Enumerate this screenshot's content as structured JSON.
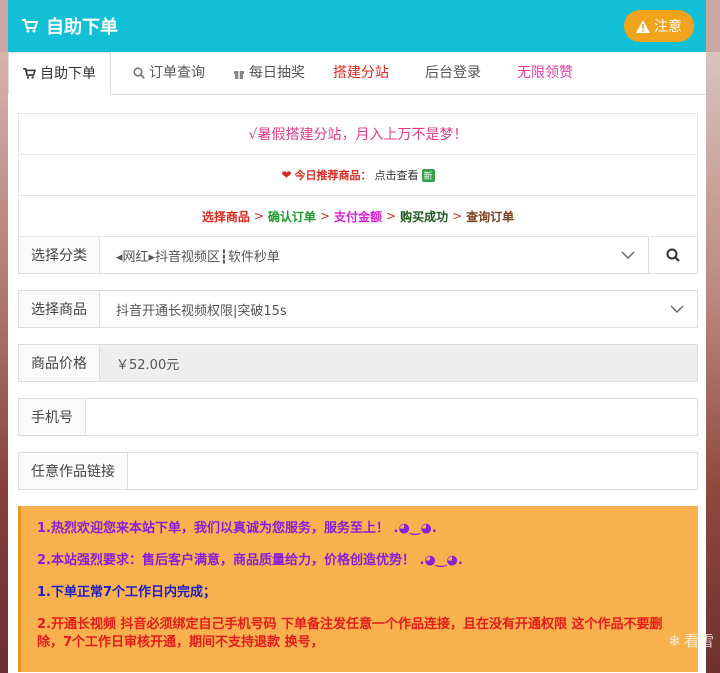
{
  "header": {
    "title": "自助下单",
    "notice_label": "注意"
  },
  "tabs": [
    {
      "label": "自助下单"
    },
    {
      "label": "订单查询"
    },
    {
      "label": "每日抽奖"
    },
    {
      "label": "搭建分站"
    },
    {
      "label": "后台登录"
    },
    {
      "label": "无限领赞"
    }
  ],
  "info": {
    "slogan": "√暑假搭建分站，月入上万不是梦！",
    "rec_label": "今日推荐商品：",
    "rec_link": "点击查看",
    "rec_badge": "新",
    "steps": [
      "选择商品",
      "确认订单",
      "支付金额",
      "购买成功",
      "查询订单"
    ],
    "step_arrow": ">"
  },
  "form": {
    "category": {
      "label": "选择分类",
      "value": "◂网红▸抖音视频区┇软件秒单"
    },
    "product": {
      "label": "选择商品",
      "value": "抖音开通长视频权限|突破15s"
    },
    "price": {
      "label": "商品价格",
      "value": "￥52.00元"
    },
    "phone": {
      "label": "手机号",
      "value": ""
    },
    "link": {
      "label": "任意作品链接",
      "value": ""
    }
  },
  "notices": [
    "1.热烈欢迎您来本站下单，我们以真诚为您服务，服务至上！ .◕‿◕.",
    "2.本站强烈要求：售后客户满意，商品质量给力，价格创造优势！ .◕‿◕.",
    "1.下单正常7个工作日内完成；",
    "2.开通长视频 抖音必须绑定自己手机号码 下单备注发任意一个作品连接，且在没有开通权限 这个作品不要删除，7个工作日审核开通，期间不支持退款 换号，"
  ],
  "watermark": "看雪",
  "colors": {
    "header": "#11bfd6",
    "notice_button": "#f2a31c",
    "notice_panel": "#f8b14e"
  }
}
